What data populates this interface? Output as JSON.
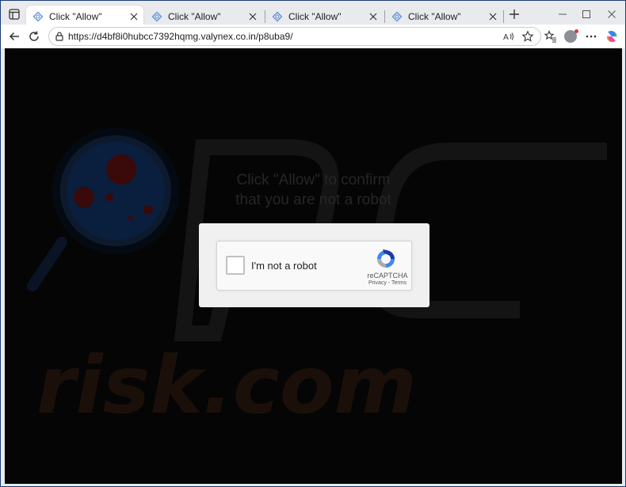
{
  "browser": {
    "tabs": [
      {
        "title": "Click \"Allow\"",
        "active": true
      },
      {
        "title": "Click \"Allow\"",
        "active": false
      },
      {
        "title": "Click \"Allow\"",
        "active": false
      },
      {
        "title": "Click \"Allow\"",
        "active": false
      }
    ],
    "address": {
      "url": "https://d4bf8i0hubcc7392hqmg.valynex.co.in/p8uba9/"
    }
  },
  "page": {
    "headline_line1": "Click \"Allow\" to confirm",
    "headline_line2": "that you are not a robot",
    "watermark_text": "risk.com",
    "watermark_colors": {
      "lens_ring": "#0d1a2e",
      "lens_fill": "#0a1e3d",
      "dots": "#3a0909",
      "letters": "#1b1009",
      "pc_outline": "#141414"
    }
  },
  "captcha": {
    "label": "I'm not a robot",
    "brand": "reCAPTCHA",
    "privacy": "Privacy",
    "separator": " - ",
    "terms": "Terms",
    "checked": false
  }
}
